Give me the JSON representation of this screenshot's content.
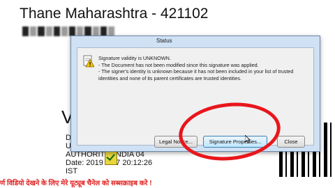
{
  "document": {
    "heading": "Thane Maharashtra - 421102",
    "big_letter": "V",
    "sig_lines": [
      "D",
      "U",
      "AUTHORIT  F INDIA 04",
      "Date: 2019 1 27 20:12:26",
      "IST"
    ]
  },
  "dialog": {
    "title": "Status",
    "messages": [
      "Signature validity is UNKNOWN.",
      "- The Document has not been modified since this signature was applied.",
      "- The signer's identity is unknown because it has not been included in your list of trusted identities and none of its parent certificates are trusted identities."
    ],
    "buttons": {
      "legal": "Legal Notice...",
      "properties": "Signature Properties...",
      "close": "Close"
    },
    "icon": "warning-certificate-icon"
  },
  "banner": {
    "text": "र्ण विडियो देखने के लिए मेरे यूट्यूब चैनेल को सब्सक्राइब करे !"
  },
  "colors": {
    "annotation_red": "#e8161c",
    "banner_red": "#e02020",
    "dialog_frame": "#cfe1f4"
  }
}
